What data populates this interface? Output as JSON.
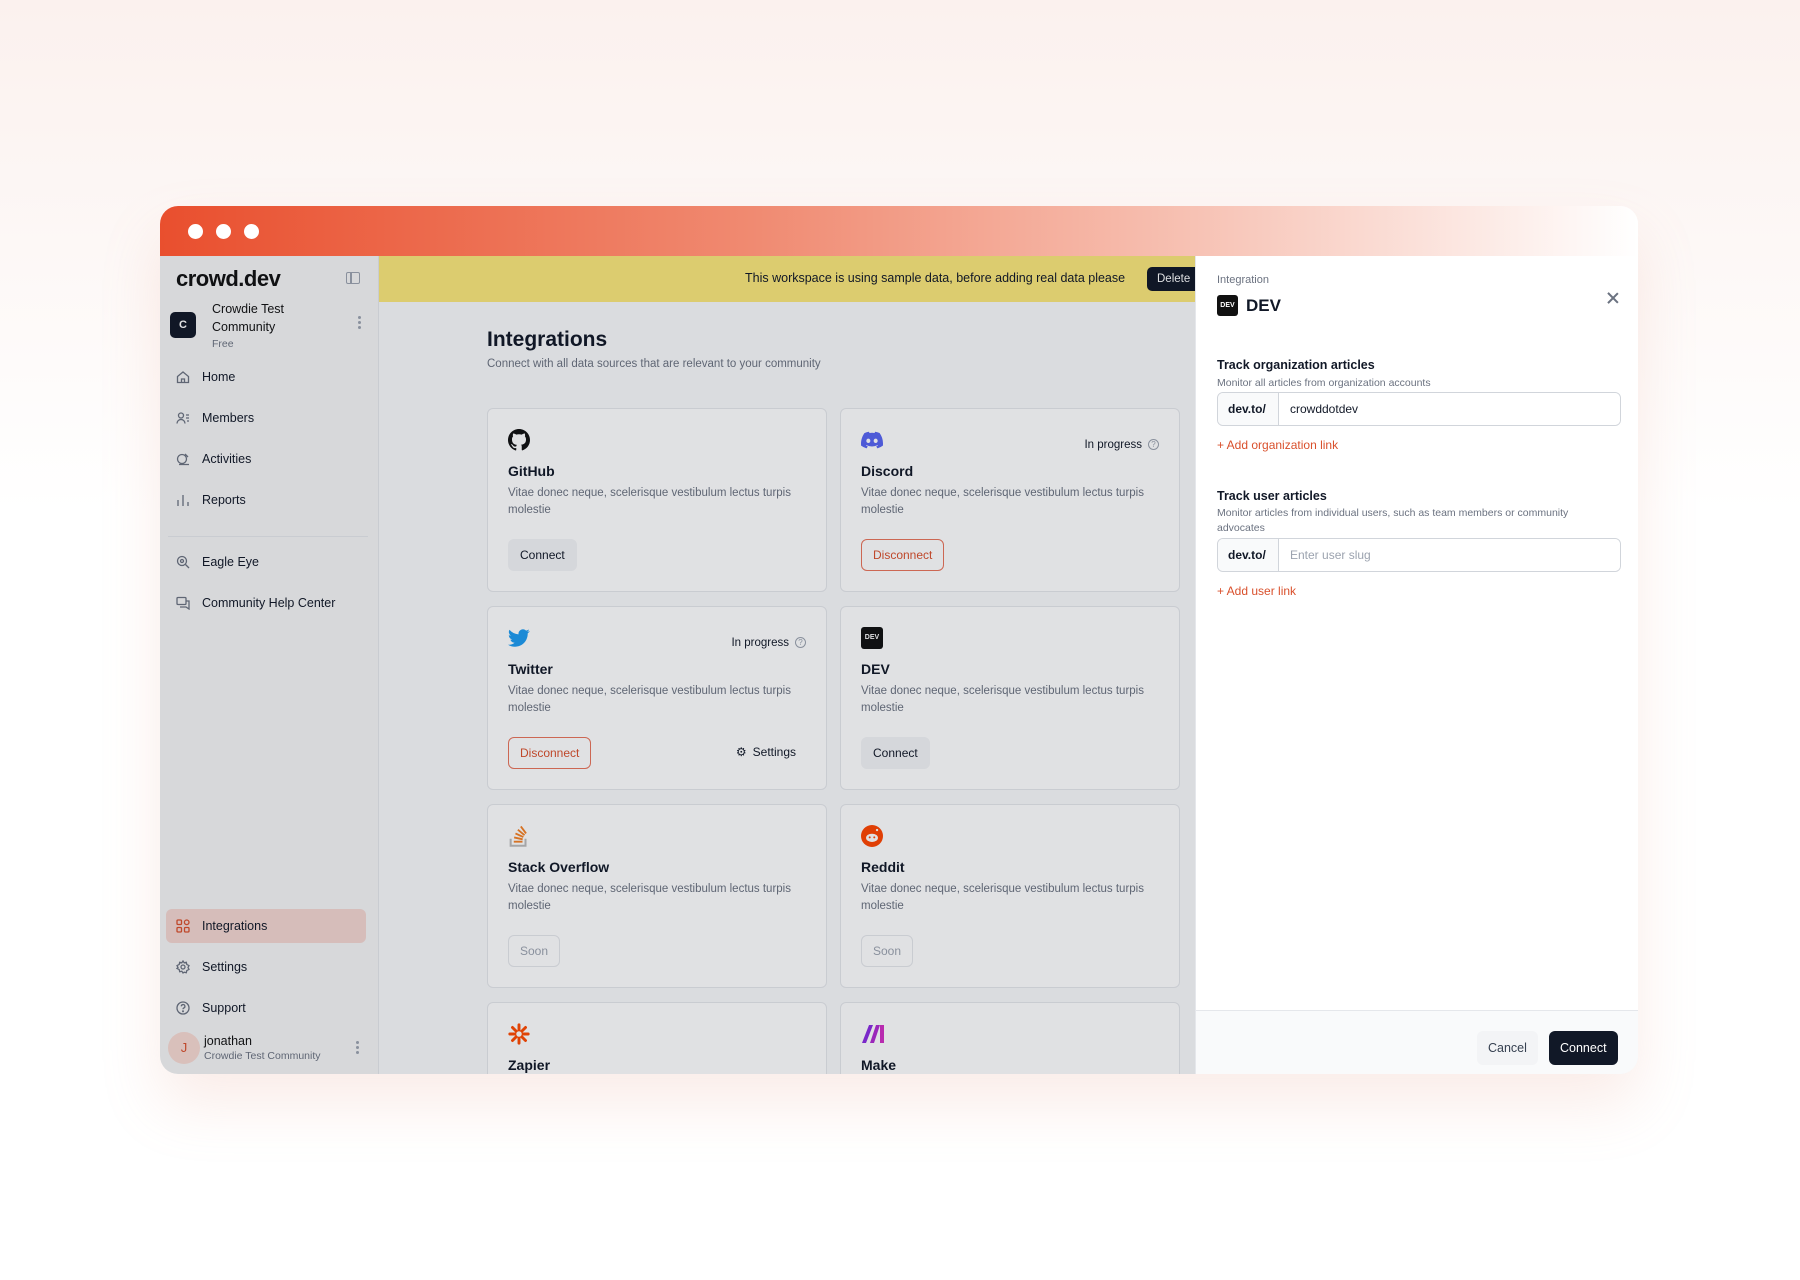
{
  "app": {
    "logo": "crowd.dev"
  },
  "workspace": {
    "avatar": "C",
    "name": "Crowdie Test Community",
    "plan": "Free"
  },
  "sidebar": {
    "items": [
      {
        "label": "Home",
        "icon": "home-icon"
      },
      {
        "label": "Members",
        "icon": "members-icon"
      },
      {
        "label": "Activities",
        "icon": "activities-icon"
      },
      {
        "label": "Reports",
        "icon": "reports-icon"
      },
      {
        "label": "Eagle Eye",
        "icon": "eagle-eye-icon"
      },
      {
        "label": "Community Help Center",
        "icon": "help-center-icon"
      }
    ],
    "bottom_items": [
      {
        "label": "Integrations",
        "icon": "integrations-icon",
        "active": true
      },
      {
        "label": "Settings",
        "icon": "settings-icon"
      },
      {
        "label": "Support",
        "icon": "support-icon"
      }
    ]
  },
  "user": {
    "avatar": "J",
    "name": "jonathan",
    "workspace": "Crowdie Test Community"
  },
  "banner": {
    "text": "This workspace is using sample data, before adding real data please",
    "button": "Delete"
  },
  "page": {
    "title": "Integrations",
    "subtitle": "Connect with all data sources that are relevant to your community"
  },
  "integrations": [
    {
      "name": "GitHub",
      "desc": "Vitae donec neque, scelerisque vestibulum lectus turpis molestie",
      "button": "Connect",
      "status": ""
    },
    {
      "name": "Discord",
      "desc": "Vitae donec neque, scelerisque vestibulum lectus turpis molestie",
      "button": "Disconnect",
      "status": "In progress"
    },
    {
      "name": "Twitter",
      "desc": "Vitae donec neque, scelerisque vestibulum lectus turpis molestie",
      "button": "Disconnect",
      "status": "In progress",
      "settings": "Settings"
    },
    {
      "name": "DEV",
      "desc": "Vitae donec neque, scelerisque vestibulum lectus turpis molestie",
      "button": "Connect",
      "status": ""
    },
    {
      "name": "Stack Overflow",
      "desc": "Vitae donec neque, scelerisque vestibulum lectus turpis molestie",
      "button": "Soon",
      "status": ""
    },
    {
      "name": "Reddit",
      "desc": "Vitae donec neque, scelerisque vestibulum lectus turpis molestie",
      "button": "Soon",
      "status": ""
    },
    {
      "name": "Zapier",
      "desc": "",
      "button": "",
      "status": ""
    },
    {
      "name": "Make",
      "desc": "",
      "button": "",
      "status": ""
    }
  ],
  "drawer": {
    "kicker": "Integration",
    "logo": "DEV",
    "title": "DEV",
    "org": {
      "title": "Track organization articles",
      "desc": "Monitor all articles from organization accounts",
      "prefix": "dev.to/",
      "value": "crowddotdev",
      "add": "+ Add organization link"
    },
    "user": {
      "title": "Track user articles",
      "desc": "Monitor articles from individual users, such as team members or community advocates",
      "prefix": "dev.to/",
      "placeholder": "Enter user slug",
      "add": "+ Add user link"
    },
    "cancel": "Cancel",
    "connect": "Connect"
  },
  "colors": {
    "accent": "#d9502c",
    "banner": "#fbe77a",
    "dark": "#111827"
  }
}
